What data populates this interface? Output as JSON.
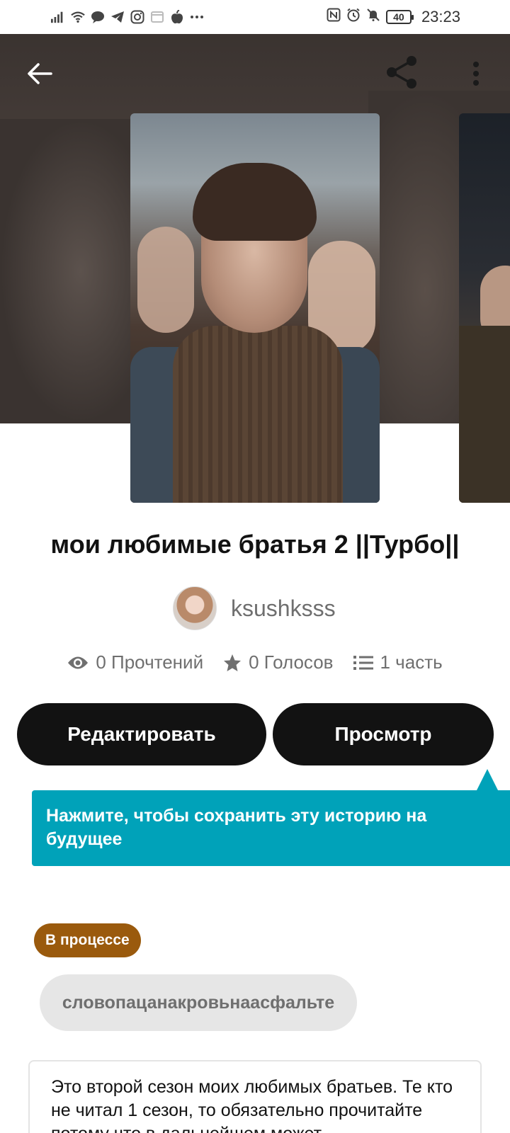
{
  "status_bar": {
    "time": "23:23",
    "battery": "40",
    "left_icons": [
      "signal-icon",
      "wifi-icon",
      "chat-icon",
      "telegram-icon",
      "instagram-icon",
      "gallery-icon",
      "apple-icon",
      "more-dots-icon"
    ],
    "right_icons": [
      "nfc-icon",
      "alarm-icon",
      "mute-icon",
      "battery-icon"
    ]
  },
  "header": {
    "back_icon": "arrow-left-icon",
    "share_icon": "share-icon",
    "more_icon": "vertical-dots-icon"
  },
  "story": {
    "title": "мои любимые братья 2 ||Турбо||",
    "author": "ksushksss",
    "reads": "0 Прочтений",
    "votes": "0 Голосов",
    "parts": "1 часть",
    "status": "В процессе",
    "tag": "словопацанакровьнаасфальте",
    "description": "Это второй сезон моих любимых братьев. Те кто не читал 1 сезон, то обязательно прочитайте потому что в дальнейшем может"
  },
  "actions": {
    "edit_label": "Редактировать",
    "view_label": "Просмотр"
  },
  "tooltip": {
    "text": "Нажмите, чтобы сохранить эту историю на будущее"
  },
  "colors": {
    "button_bg": "#121212",
    "tooltip_bg": "#00a2b9",
    "status_badge_bg": "#9a5a0d",
    "tag_bg": "#e6e6e6"
  }
}
